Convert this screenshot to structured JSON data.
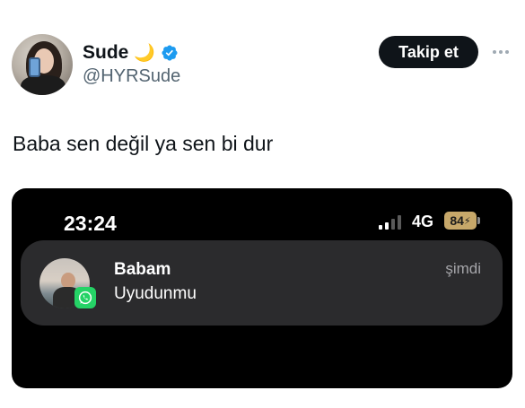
{
  "user": {
    "display_name": "Sude",
    "name_emoji": "moon-emoji",
    "verified": true,
    "handle": "@HYRSude"
  },
  "actions": {
    "follow_label": "Takip et",
    "more_icon": "more-horizontal-icon"
  },
  "tweet": {
    "text": "Baba sen değil ya sen bi dur"
  },
  "screenshot": {
    "status_bar": {
      "time": "23:24",
      "network": "4G",
      "battery": "84"
    },
    "notification": {
      "app_icon": "whatsapp-icon",
      "sender": "Babam",
      "message": "Uyudunmu",
      "time": "şimdi"
    }
  },
  "colors": {
    "follow_button_bg": "#0f1419",
    "verified_badge": "#1d9bf0",
    "whatsapp_green": "#25d366",
    "battery_low_power": "#c7a86a"
  }
}
